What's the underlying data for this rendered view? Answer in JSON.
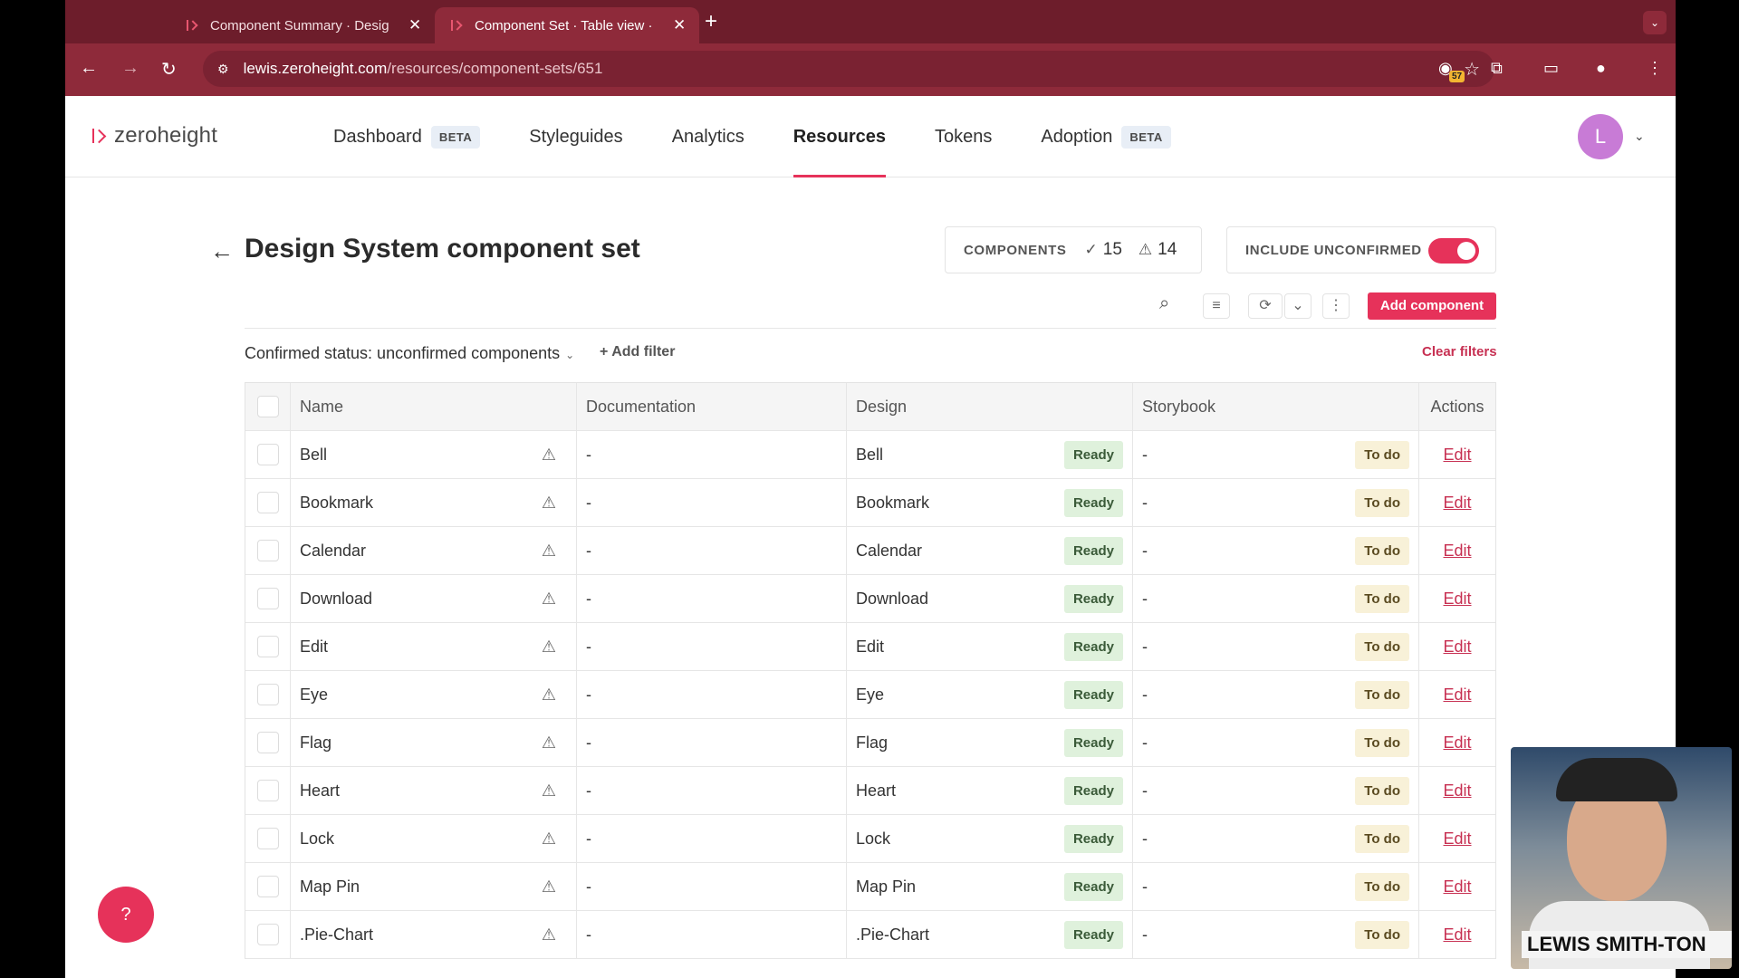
{
  "browser": {
    "tabs": [
      {
        "title": "Component Summary · Desig",
        "active": false
      },
      {
        "title": "Component Set · Table view ·",
        "active": true
      }
    ],
    "url_host": "lewis.zeroheight.com",
    "url_path": "/resources/component-sets/651",
    "extension_badge": "57"
  },
  "app": {
    "logo": "zeroheight",
    "nav": [
      {
        "label": "Dashboard",
        "badge": "BETA",
        "active": false
      },
      {
        "label": "Styleguides",
        "badge": "",
        "active": false
      },
      {
        "label": "Analytics",
        "badge": "",
        "active": false
      },
      {
        "label": "Resources",
        "badge": "",
        "active": true
      },
      {
        "label": "Tokens",
        "badge": "",
        "active": false
      },
      {
        "label": "Adoption",
        "badge": "BETA",
        "active": false
      }
    ],
    "avatar_initial": "L"
  },
  "page": {
    "title": "Design System component set",
    "components_label": "COMPONENTS",
    "confirmed_count": "15",
    "unconfirmed_count": "14",
    "include_unconfirmed_label": "INCLUDE UNCONFIRMED",
    "include_unconfirmed_on": true,
    "add_component_label": "Add component",
    "filter_label": "Confirmed status: unconfirmed components",
    "add_filter_label": "Add filter",
    "clear_filters_label": "Clear filters",
    "help_label": "?"
  },
  "table": {
    "headers": {
      "name": "Name",
      "documentation": "Documentation",
      "design": "Design",
      "storybook": "Storybook",
      "actions": "Actions"
    },
    "rows": [
      {
        "name": "Bell",
        "documentation": "-",
        "design": "Bell",
        "design_status": "Ready",
        "storybook": "-",
        "storybook_status": "To do",
        "action": "Edit"
      },
      {
        "name": "Bookmark",
        "documentation": "-",
        "design": "Bookmark",
        "design_status": "Ready",
        "storybook": "-",
        "storybook_status": "To do",
        "action": "Edit"
      },
      {
        "name": "Calendar",
        "documentation": "-",
        "design": "Calendar",
        "design_status": "Ready",
        "storybook": "-",
        "storybook_status": "To do",
        "action": "Edit"
      },
      {
        "name": "Download",
        "documentation": "-",
        "design": "Download",
        "design_status": "Ready",
        "storybook": "-",
        "storybook_status": "To do",
        "action": "Edit"
      },
      {
        "name": "Edit",
        "documentation": "-",
        "design": "Edit",
        "design_status": "Ready",
        "storybook": "-",
        "storybook_status": "To do",
        "action": "Edit"
      },
      {
        "name": "Eye",
        "documentation": "-",
        "design": "Eye",
        "design_status": "Ready",
        "storybook": "-",
        "storybook_status": "To do",
        "action": "Edit"
      },
      {
        "name": "Flag",
        "documentation": "-",
        "design": "Flag",
        "design_status": "Ready",
        "storybook": "-",
        "storybook_status": "To do",
        "action": "Edit"
      },
      {
        "name": "Heart",
        "documentation": "-",
        "design": "Heart",
        "design_status": "Ready",
        "storybook": "-",
        "storybook_status": "To do",
        "action": "Edit"
      },
      {
        "name": "Lock",
        "documentation": "-",
        "design": "Lock",
        "design_status": "Ready",
        "storybook": "-",
        "storybook_status": "To do",
        "action": "Edit"
      },
      {
        "name": "Map Pin",
        "documentation": "-",
        "design": "Map Pin",
        "design_status": "Ready",
        "storybook": "-",
        "storybook_status": "To do",
        "action": "Edit"
      },
      {
        "name": ".Pie-Chart",
        "documentation": "-",
        "design": ".Pie-Chart",
        "design_status": "Ready",
        "storybook": "-",
        "storybook_status": "To do",
        "action": "Edit"
      }
    ]
  },
  "webcam": {
    "name": "LEWIS SMITH-TON"
  },
  "colors": {
    "accent": "#e6325a",
    "ready_bg": "#dff1dc",
    "todo_bg": "#f8f1d8"
  }
}
